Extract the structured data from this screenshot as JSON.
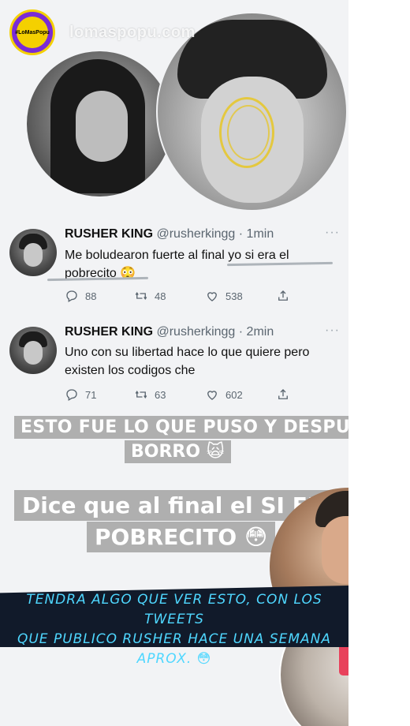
{
  "header": {
    "logo_text": "#LoMasPopu",
    "username": "lomaspopu.com"
  },
  "tweets": [
    {
      "name": "RUSHER KING",
      "handle": "@rusherkingg",
      "separator": "·",
      "time": "1min",
      "more": "···",
      "text": "Me boludearon fuerte al final yo si era el pobrecito 😳",
      "replies": "88",
      "retweets": "48",
      "likes": "538"
    },
    {
      "name": "RUSHER KING",
      "handle": "@rusherkingg",
      "separator": "·",
      "time": "2min",
      "more": "···",
      "text": "Uno con su libertad hace lo que quiere pero existen los codigos che",
      "replies": "71",
      "retweets": "63",
      "likes": "602"
    }
  ],
  "captions": {
    "line1a": "ESTO FUE LO QUE PUSO Y DESPUÉS",
    "line1b": "BORRO 🙀",
    "line2a": "Dice que al final el SI ERA EL",
    "line2b": "POBRECITO 😳"
  },
  "banner": {
    "line1": "TENDRA ALGO QUE VER  ESTO, CON LOS TWEETS",
    "line2": "QUE PUBLICO RUSHER HACE UNA SEMANA",
    "line3": "APROX. 😳"
  },
  "colors": {
    "background": "#f2f3f5",
    "banner": "#111a2a",
    "banner_text": "#4fd7ff",
    "caption_bg": "#a0a0a0"
  }
}
